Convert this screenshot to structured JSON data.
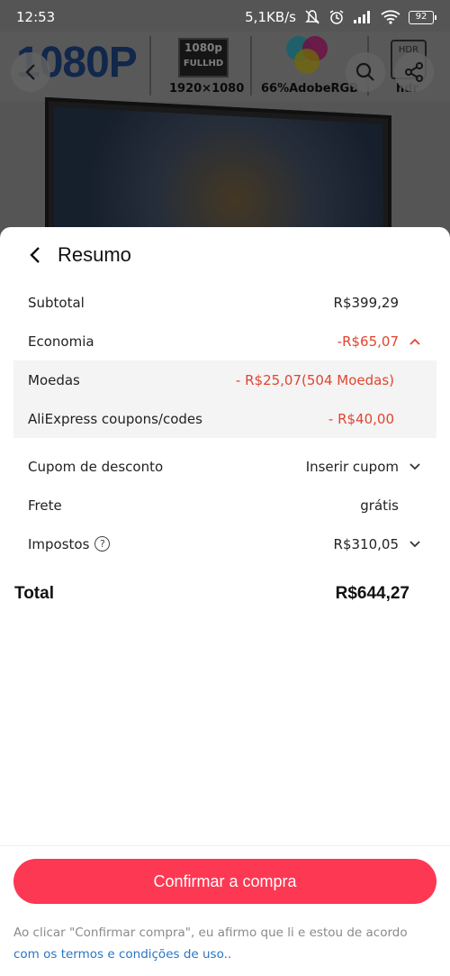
{
  "status_bar": {
    "time": "12:53",
    "speed": "5,1KB/s",
    "battery": "92"
  },
  "background": {
    "banner_big": "1080P",
    "badge_fhd_top": "1080p",
    "badge_fhd_bottom": "FULLHD",
    "resolution": "1920×1080",
    "color_gamut": "66%AdobeRGB",
    "hdr_badge": "HDR",
    "hdr_label": "hdr"
  },
  "sheet": {
    "title": "Resumo",
    "rows": {
      "subtotal": {
        "label": "Subtotal",
        "value": "R$399,29"
      },
      "economia": {
        "label": "Economia",
        "value": "-R$65,07"
      },
      "moedas": {
        "label": "Moedas",
        "value": "- R$25,07(504 Moedas)"
      },
      "coupons": {
        "label": "AliExpress coupons/codes",
        "value": "- R$40,00"
      },
      "cupom": {
        "label": "Cupom de desconto",
        "value": "Inserir cupom"
      },
      "frete": {
        "label": "Frete",
        "value": "grátis"
      },
      "impostos": {
        "label": "Impostos",
        "value": "R$310,05"
      }
    },
    "total": {
      "label": "Total",
      "value": "R$644,27"
    },
    "confirm_label": "Confirmar a compra",
    "legal_text": "Ao clicar \"Confirmar compra\", eu afirmo que li e estou de acordo",
    "legal_link": "com os termos e condições de uso.."
  },
  "colors": {
    "accent": "#fd3853",
    "discount": "#e2442f",
    "link": "#2776c7"
  },
  "icons": {
    "back": "chevron-left-icon",
    "expand": "chevron-up-icon",
    "dropdown": "chevron-down-icon",
    "help": "question-circle-icon",
    "search": "search-icon",
    "share": "share-icon"
  }
}
